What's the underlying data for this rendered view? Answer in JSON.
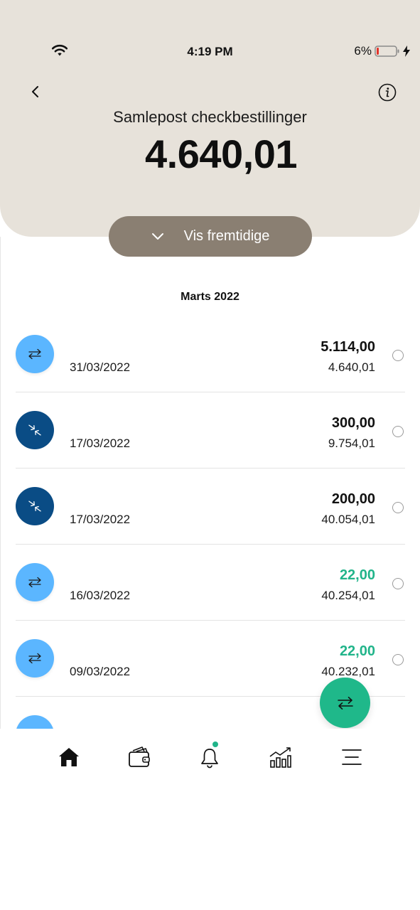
{
  "status_bar": {
    "time": "4:19 PM",
    "battery": "6%"
  },
  "header": {
    "account_name": "Samlepost checkbestillinger",
    "balance": "4.640,01",
    "future_button_label": "Vis fremtidige"
  },
  "month": "Marts 2022",
  "transactions": [
    {
      "date": "31/03/2022",
      "amount": "5.114,00",
      "balance": "4.640,01",
      "icon": "transfer-light"
    },
    {
      "date": "17/03/2022",
      "amount": "300,00",
      "balance": "9.754,01",
      "icon": "transfer-dark"
    },
    {
      "date": "17/03/2022",
      "amount": "200,00",
      "balance": "40.054,01",
      "icon": "transfer-dark"
    },
    {
      "date": "16/03/2022",
      "amount": "22,00",
      "balance": "40.254,01",
      "icon": "transfer-light"
    },
    {
      "date": "09/03/2022",
      "amount": "22,00",
      "balance": "40.232,01",
      "icon": "transfer-light"
    }
  ],
  "tabs": [
    {
      "name": "home",
      "icon": "home-icon"
    },
    {
      "name": "wallet",
      "icon": "wallet-icon"
    },
    {
      "name": "notifications",
      "icon": "bell-icon"
    },
    {
      "name": "investments",
      "icon": "chart-icon"
    },
    {
      "name": "menu",
      "icon": "menu-icon"
    }
  ],
  "colors": {
    "header_bg": "#e7e2da",
    "future_button": "#8a7f72",
    "icon_light": "#5bb6ff",
    "icon_dark": "#0a4c85",
    "positive": "#21b48a",
    "fab": "#1fb88a"
  }
}
